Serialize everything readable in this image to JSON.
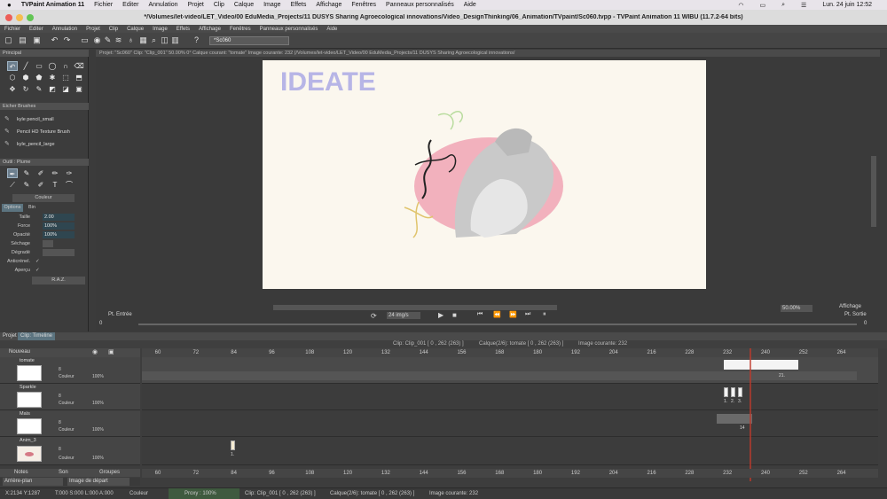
{
  "mac_menu": {
    "apple": "",
    "app_name": "TVPaint Animation 11",
    "items": [
      "Fichier",
      "Editer",
      "Annulation",
      "Projet",
      "Clip",
      "Calque",
      "Image",
      "Effets",
      "Affichage",
      "Fenêtres",
      "Panneaux personnalisés",
      "Aide"
    ],
    "clock": "Lun. 24 juin  12:52"
  },
  "window_title": "*/Volumes/let-video/LET_Video/00 EduMedia_Projects/11 DUSYS Sharing Agroecological innovations/Video_DesignThinking/06_Animation/TVpaint/Sc060.tvpp - TVPaint Animation 11 WIBU (11.7.2-64 bits)",
  "app_menu": [
    "Fichier",
    "Editer",
    "Annulation",
    "Projet",
    "Clip",
    "Calque",
    "Image",
    "Effets",
    "Affichage",
    "Fenêtres",
    "Panneaux personnalisés",
    "Aide"
  ],
  "toolbar": {
    "path_value": "*Sc060"
  },
  "panels": {
    "principal": "Principal",
    "brushes_header": "Eicher Brushes",
    "brushes": [
      "kyle pencil_small",
      "Pencil HD Texture Brush",
      "kyle_pencil_large"
    ],
    "tool_header": "Outil : Plume",
    "couleur_tab": "Couleur",
    "options_tab": "Options",
    "bin_tab": "Bin",
    "taille_label": "Taille",
    "taille_value": "2.00",
    "force_label": "Force",
    "force_value": "100%",
    "opacite_label": "Opacité",
    "opacite_value": "100%",
    "sechage_label": "Séchage",
    "degrade_label": "Dégradé",
    "anticrenel_label": "Anticrénel.",
    "apercu_label": "Aperçu",
    "raz_label": "R.A.Z."
  },
  "canvas": {
    "info": "Projet: \"Sc060\"  Clip: \"Clip_001\"  50.00%  0°  Calque courant: \"tomate\"  Image courante: 232 (/Volumes/let-video/LET_Video/00 EduMedia_Projects/11 DUSYS Sharing Agroecological innovations/",
    "art_title": "IDEATE"
  },
  "playbar": {
    "pt_entree": "Pt. Entrée",
    "pt_sortie": "Pt. Sortie",
    "fps": "24 img/s",
    "zoom": "50.00%",
    "affichage": "Affichage",
    "left_num": "0",
    "right_num": "0"
  },
  "timeline": {
    "tab_projet": "Projet",
    "tab_clip": "Clip: Timeline",
    "clip_info": "Clip: Clip_001 [ 0 , 262  (263) ]",
    "layer_info": "Calque(2/6): tomate [ 0 , 262  (263) ]",
    "frame_info": "Image courante: 232",
    "nouveau": "Nouveau",
    "ruler_ticks": [
      "60",
      "72",
      "84",
      "96",
      "108",
      "120",
      "132",
      "144",
      "156",
      "168",
      "180",
      "192",
      "204",
      "216",
      "228",
      "232",
      "240",
      "252",
      "264"
    ],
    "layers": [
      {
        "name": "tomate",
        "mode": "Couleur",
        "opacity": "100%",
        "num": "8"
      },
      {
        "name": "Sparkle",
        "mode": "Couleur",
        "opacity": "100%",
        "num": "8"
      },
      {
        "name": "Maïs",
        "mode": "Couleur",
        "opacity": "100%",
        "num": "8"
      },
      {
        "name": "Anim_3",
        "mode": "Couleur",
        "opacity": "100%",
        "num": "8"
      }
    ],
    "frame_labels": [
      "1.",
      "2.",
      "3.",
      "21.",
      "14",
      "1."
    ],
    "notes": "Notes",
    "son": "Son",
    "groupes": "Groupes",
    "arriere_plan": "Arrière-plan",
    "image_depart": "Image de départ"
  },
  "statusbar": {
    "coords": "X:2134  Y:1287",
    "timings": "T:000 S:000 L:000 A:000",
    "couleur": "Couleur",
    "proxy": "Proxy : 100%",
    "clip": "Clip: Clip_001 [ 0 , 262  (263) ]",
    "calque": "Calque(2/6): tomate [ 0 , 262  (263) ]",
    "image": "Image courante: 232"
  },
  "colors": {
    "accent": "#6d7f8e",
    "ideate": "#b7b5e6",
    "canvas_bg": "#fbf7ee",
    "oval": "#ef9fb0",
    "playhead": "#c0392b"
  },
  "icons": [
    "undo-icon",
    "redo-icon",
    "brush-icon",
    "lasso-icon",
    "zoom-icon",
    "play-icon",
    "stop-icon",
    "eye-icon",
    "lock-icon"
  ]
}
